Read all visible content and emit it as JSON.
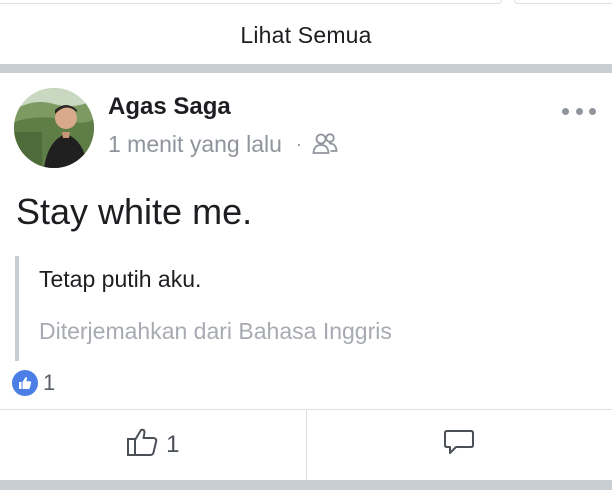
{
  "feed": {
    "see_all_label": "Lihat Semua"
  },
  "post": {
    "author": "Agas Saga",
    "timestamp": "1 menit yang lalu",
    "separator": "·",
    "audience_icon": "friends-icon",
    "text": "Stay white me.",
    "translation": {
      "text": "Tetap putih aku.",
      "note": "Diterjemahkan dari Bahasa Inggris"
    },
    "reactions": {
      "icon": "like-icon",
      "count": "1"
    },
    "actions": {
      "like_count": "1",
      "like_icon": "thumbs-up-icon",
      "comment_icon": "comment-icon"
    }
  },
  "colors": {
    "divider": "#c9ced3",
    "secondary_text": "#90949c",
    "like_blue": "#4c7fe6"
  }
}
